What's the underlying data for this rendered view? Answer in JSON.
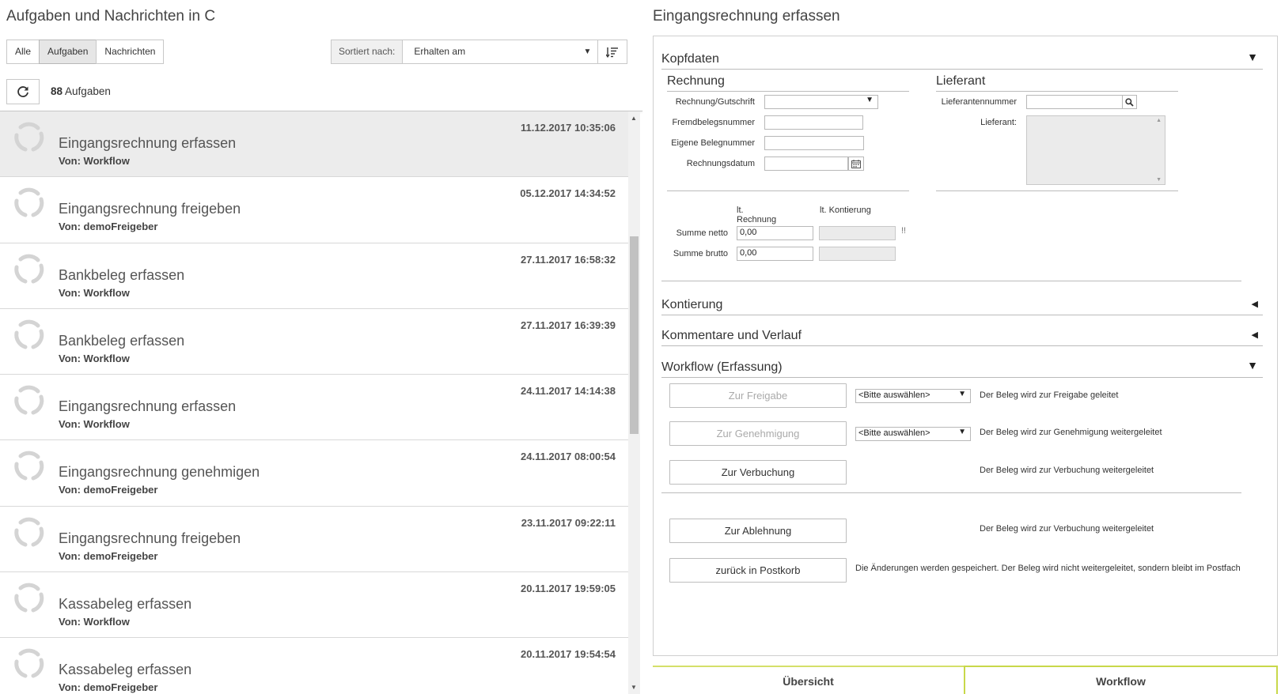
{
  "left": {
    "title": "Aufgaben und Nachrichten in C",
    "filters": [
      "Alle",
      "Aufgaben",
      "Nachrichten"
    ],
    "active_filter": "Aufgaben",
    "sort_label": "Sortiert nach:",
    "sort_value": "Erhalten am",
    "count_number": "88",
    "count_label": "Aufgaben",
    "from_label": "Von:",
    "tasks": [
      {
        "title": "Eingangsrechnung erfassen",
        "from": "Workflow",
        "date": "11.12.2017 10:35:06"
      },
      {
        "title": "Eingangsrechnung freigeben",
        "from": "demoFreigeber",
        "date": "05.12.2017 14:34:52"
      },
      {
        "title": "Bankbeleg erfassen",
        "from": "Workflow",
        "date": "27.11.2017 16:58:32"
      },
      {
        "title": "Bankbeleg erfassen",
        "from": "Workflow",
        "date": "27.11.2017 16:39:39"
      },
      {
        "title": "Eingangsrechnung erfassen",
        "from": "Workflow",
        "date": "24.11.2017 14:14:38"
      },
      {
        "title": "Eingangsrechnung genehmigen",
        "from": "demoFreigeber",
        "date": "24.11.2017 08:00:54"
      },
      {
        "title": "Eingangsrechnung freigeben",
        "from": "demoFreigeber",
        "date": "23.11.2017 09:22:11"
      },
      {
        "title": "Kassabeleg erfassen",
        "from": "Workflow",
        "date": "20.11.2017 19:59:05"
      },
      {
        "title": "Kassabeleg erfassen",
        "from": "demoFreigeber",
        "date": "20.11.2017 19:54:54"
      }
    ]
  },
  "right": {
    "title": "Eingangsrechnung erfassen",
    "sections": {
      "kopfdaten": "Kopfdaten",
      "kontierung": "Kontierung",
      "kommentare": "Kommentare und Verlauf",
      "workflow": "Workflow (Erfassung)"
    },
    "rechnung": {
      "heading": "Rechnung",
      "type_label": "Rechnung/Gutschrift",
      "fremd_label": "Fremdbelegsnummer",
      "eigene_label": "Eigene Belegnummer",
      "datum_label": "Rechnungsdatum"
    },
    "lieferant": {
      "heading": "Lieferant",
      "nummer_label": "Lieferantennummer",
      "name_label": "Lieferant:"
    },
    "summen": {
      "col_rechnung": "lt. Rechnung",
      "col_kontierung": "lt. Kontierung",
      "netto_label": "Summe netto",
      "brutto_label": "Summe brutto",
      "netto_value": "0,00",
      "brutto_value": "0,00",
      "warning": "!!"
    },
    "workflow": {
      "freigabe_btn": "Zur Freigabe",
      "freigabe_select": "<Bitte auswählen>",
      "freigabe_desc": "Der Beleg wird zur Freigabe geleitet",
      "genehmigung_btn": "Zur Genehmigung",
      "genehmigung_select": "<Bitte auswählen>",
      "genehmigung_desc": "Der Beleg wird zur Genehmigung weitergeleitet",
      "verbuchung_btn": "Zur Verbuchung",
      "verbuchung_desc": "Der Beleg wird zur Verbuchung weitergeleitet",
      "ablehnung_btn": "Zur Ablehnung",
      "ablehnung_desc": "Der Beleg wird zur Verbuchung weitergeleitet",
      "postkorb_btn": "zurück in Postkorb",
      "postkorb_desc": "Die Änderungen werden gespeichert. Der Beleg wird nicht weitergeleitet, sondern bleibt im Postfach"
    },
    "tabs": [
      "Übersicht",
      "Workflow"
    ],
    "active_tab": "Workflow"
  },
  "colors": {
    "accent_tab": "#c8d84a",
    "selected_row": "#ececec"
  }
}
